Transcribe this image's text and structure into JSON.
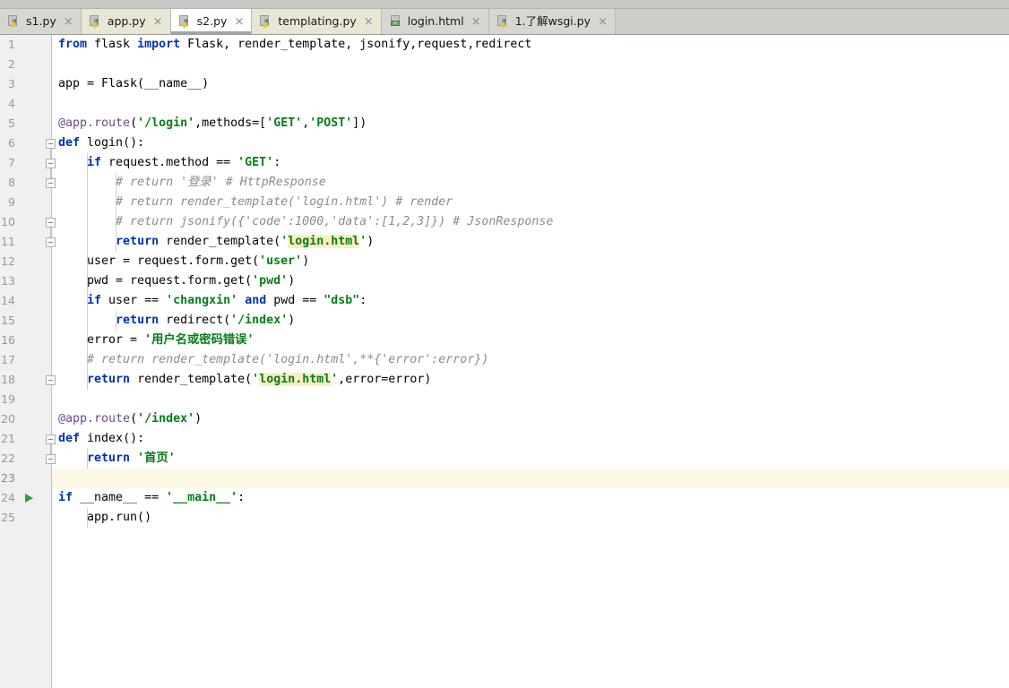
{
  "window": {
    "app": "PyCharm-style Python editor",
    "active_file": "s2.py"
  },
  "tabs": [
    {
      "label": "s1.py",
      "icon": "python-file-icon",
      "active": false,
      "close": "×",
      "shade": "a"
    },
    {
      "label": "app.py",
      "icon": "python-file-icon",
      "active": false,
      "close": "×",
      "shade": "b"
    },
    {
      "label": "s2.py",
      "icon": "python-file-icon",
      "active": true,
      "close": "×",
      "shade": "active"
    },
    {
      "label": "templating.py",
      "icon": "python-file-icon",
      "active": false,
      "close": "×",
      "shade": "b"
    },
    {
      "label": "login.html",
      "icon": "html-file-icon",
      "active": false,
      "close": "×",
      "shade": "a"
    },
    {
      "label": "1.了解wsgi.py",
      "icon": "python-file-icon",
      "active": false,
      "close": "×",
      "shade": "a"
    }
  ],
  "editor": {
    "caret_line": 23,
    "run_marker_line": 24,
    "line_numbers": [
      1,
      2,
      3,
      4,
      5,
      6,
      7,
      8,
      9,
      10,
      11,
      12,
      13,
      14,
      15,
      16,
      17,
      18,
      19,
      20,
      21,
      22,
      23,
      24,
      25
    ],
    "lines": [
      "from flask import Flask, render_template, jsonify,request,redirect",
      "",
      "app = Flask(__name__)",
      "",
      "@app.route('/login',methods=['GET','POST'])",
      "def login():",
      "    if request.method == 'GET':",
      "        # return '登录' # HttpResponse",
      "        # return render_template('login.html') # render",
      "        # return jsonify({'code':1000,'data':[1,2,3]}) # JsonResponse",
      "        return render_template('login.html')",
      "    user = request.form.get('user')",
      "    pwd = request.form.get('pwd')",
      "    if user == 'changxin' and pwd == \"dsb\":",
      "        return redirect('/index')",
      "    error = '用户名或密码错误'",
      "    # return render_template('login.html',**{'error':error})",
      "    return render_template('login.html',error=error)",
      "",
      "@app.route('/index')",
      "def index():",
      "    return '首页'",
      "",
      "if __name__ == '__main__':",
      "    app.run()"
    ],
    "highlighted_token": "login.html",
    "fold_lines": [
      6,
      7,
      8,
      10,
      11,
      18,
      21,
      22
    ]
  },
  "colors": {
    "keyword": "#0033b3",
    "string": "#067d17",
    "comment": "#8c8c8c",
    "decorator": "#9876aa",
    "number": "#1750eb",
    "search_highlight": "#fbeec1",
    "caret_line": "#fdf8e4",
    "run_arrow": "#389c38",
    "gutter_bg": "#f0f0f0",
    "tab_bar_bg": "#cdcdc9"
  }
}
